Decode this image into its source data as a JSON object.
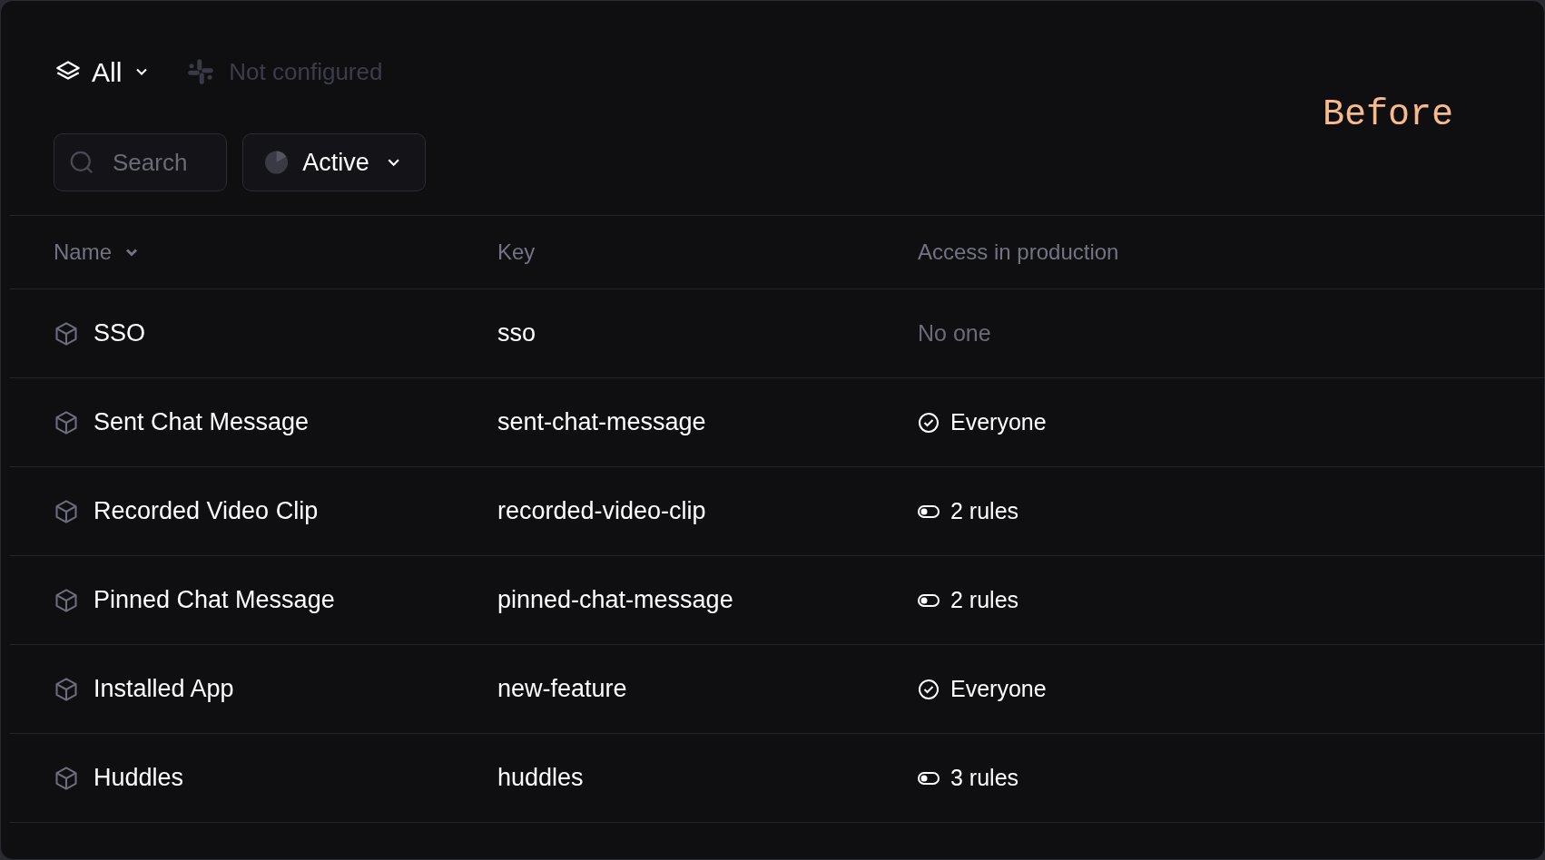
{
  "toolbar": {
    "scope": {
      "label": "All"
    },
    "integration": {
      "label": "Not configured",
      "disabled": true
    }
  },
  "filters": {
    "search": {
      "placeholder": "Search"
    },
    "status": {
      "label": "Active"
    }
  },
  "caption": "Before",
  "table": {
    "columns": [
      {
        "label": "Name",
        "sorted": true
      },
      {
        "label": "Key",
        "sorted": false
      },
      {
        "label": "Access in production",
        "sorted": false
      }
    ],
    "rows": [
      {
        "name": "SSO",
        "key": "sso",
        "access": {
          "kind": "none",
          "label": "No one"
        }
      },
      {
        "name": "Sent Chat Message",
        "key": "sent-chat-message",
        "access": {
          "kind": "everyone",
          "label": "Everyone"
        }
      },
      {
        "name": "Recorded Video Clip",
        "key": "recorded-video-clip",
        "access": {
          "kind": "rules",
          "label": "2 rules"
        }
      },
      {
        "name": "Pinned Chat Message",
        "key": "pinned-chat-message",
        "access": {
          "kind": "rules",
          "label": "2 rules"
        }
      },
      {
        "name": "Installed App",
        "key": "new-feature",
        "access": {
          "kind": "everyone",
          "label": "Everyone"
        }
      },
      {
        "name": "Huddles",
        "key": "huddles",
        "access": {
          "kind": "rules",
          "label": "3 rules"
        }
      }
    ]
  }
}
